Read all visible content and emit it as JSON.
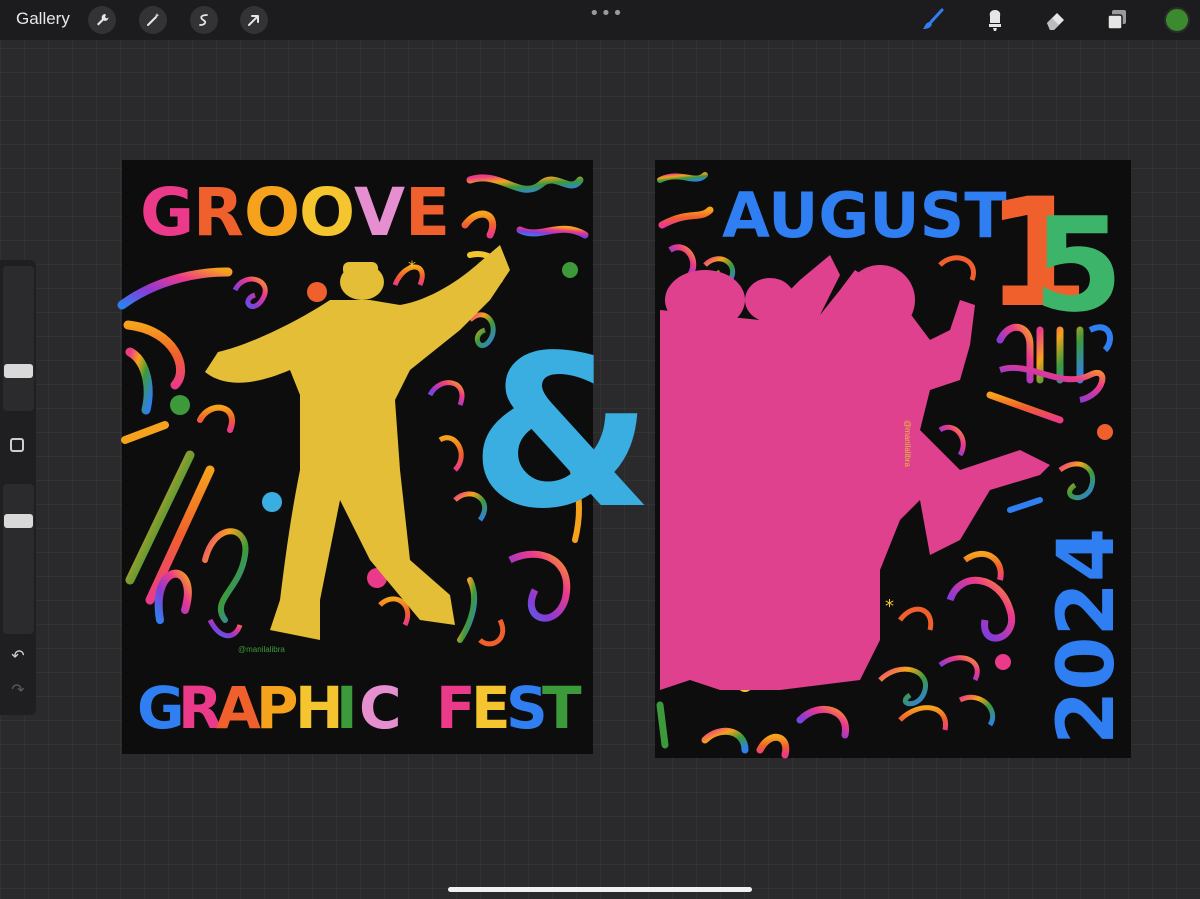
{
  "toolbar": {
    "gallery_label": "Gallery",
    "left_tools": [
      "wrench-icon",
      "magic-wand-icon",
      "selection-icon",
      "transform-arrow-icon"
    ],
    "more_menu": "•••",
    "right_tools": [
      "brush-icon",
      "smudge-icon",
      "eraser-icon",
      "layers-icon"
    ],
    "active_color": "#3c8a2e",
    "brush_active_color": "#2f7ff2"
  },
  "sidebar": {
    "undo": "↶",
    "redo": "↷"
  },
  "artwork": {
    "left_poster": {
      "headline_letters": [
        "G",
        "R",
        "O",
        "O",
        "V",
        "E"
      ],
      "headline_colors": [
        "#ec3a8b",
        "#f0602c",
        "#f7a21c",
        "#f4c52e",
        "#e58fd0",
        "#f0602c"
      ],
      "ampersand": "&",
      "footer_letters": [
        "G",
        "R",
        "A",
        "P",
        "H",
        "I",
        "C",
        " ",
        "F",
        "E",
        "S",
        "T"
      ],
      "footer_colors": [
        "#2f7ff2",
        "#ec3a8b",
        "#f0602c",
        "#f7a21c",
        "#f4c52e",
        "#3c9a3a",
        "#e58fd0",
        "",
        "#ec3a8b",
        "#f4c52e",
        "#2f7ff2",
        "#3c9a3a"
      ],
      "credit": "@manilalibra",
      "figure_color": "#e3be36",
      "ampersand_color": "#3aaee0"
    },
    "right_poster": {
      "month": "AUGUST",
      "day_first_digit": "1",
      "day_second_digit": "5",
      "year": "2024",
      "credit": "@manilalibra",
      "month_color": "#2f7ff2",
      "day_first_color": "#f0602c",
      "day_second_color": "#3cb56a",
      "year_color": "#2f7ff2",
      "figure_color": "#e0418f"
    }
  }
}
